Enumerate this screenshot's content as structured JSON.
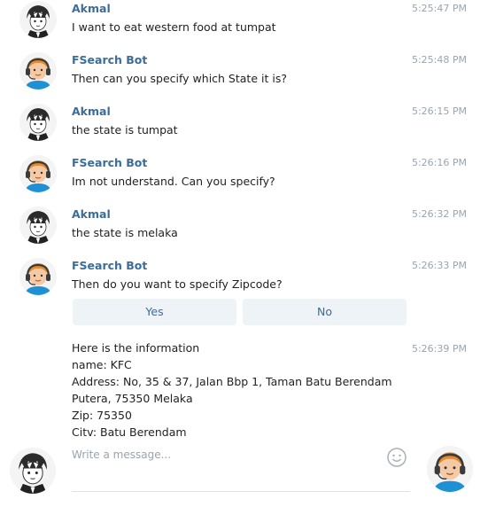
{
  "messages": [
    {
      "sender": "Akmal",
      "avatar": "user-avatar-icon",
      "time": "5:25:47 PM",
      "text": "I want to eat western food at tumpat"
    },
    {
      "sender": "FSearch Bot",
      "avatar": "bot-avatar-icon",
      "time": "5:25:48 PM",
      "text": "Then can you specify which State it is?"
    },
    {
      "sender": "Akmal",
      "avatar": "user-avatar-icon",
      "time": "5:26:15 PM",
      "text": "the state is tumpat"
    },
    {
      "sender": "FSearch Bot",
      "avatar": "bot-avatar-icon",
      "time": "5:26:16 PM",
      "text": "Im not understand. Can you specify?"
    },
    {
      "sender": "Akmal",
      "avatar": "user-avatar-icon",
      "time": "5:26:32 PM",
      "text": "the state is melaka"
    },
    {
      "sender": "FSearch Bot",
      "avatar": "bot-avatar-icon",
      "time": "5:26:33 PM",
      "text": "Then do you want to specify Zipcode?"
    }
  ],
  "keyboard": {
    "yes_label": "Yes",
    "no_label": "No"
  },
  "info_message": {
    "time": "5:26:39 PM",
    "lines": [
      "Here is the information",
      "name: KFC",
      "Address: No, 35 & 37, Jalan Bbp 1, Taman Batu Berendam",
      "Putera, 75350 Melaka",
      "Zip: 75350",
      "Citv: Batu Berendam"
    ]
  },
  "composer": {
    "placeholder": "Write a message...",
    "emoji_icon": "smiley-icon"
  },
  "colors": {
    "name": "#3a6d99",
    "time": "#9aa4ad",
    "button_bg": "#eef3f7",
    "bot_headset": "#1e90d6",
    "bot_hair": "#e8892a"
  }
}
